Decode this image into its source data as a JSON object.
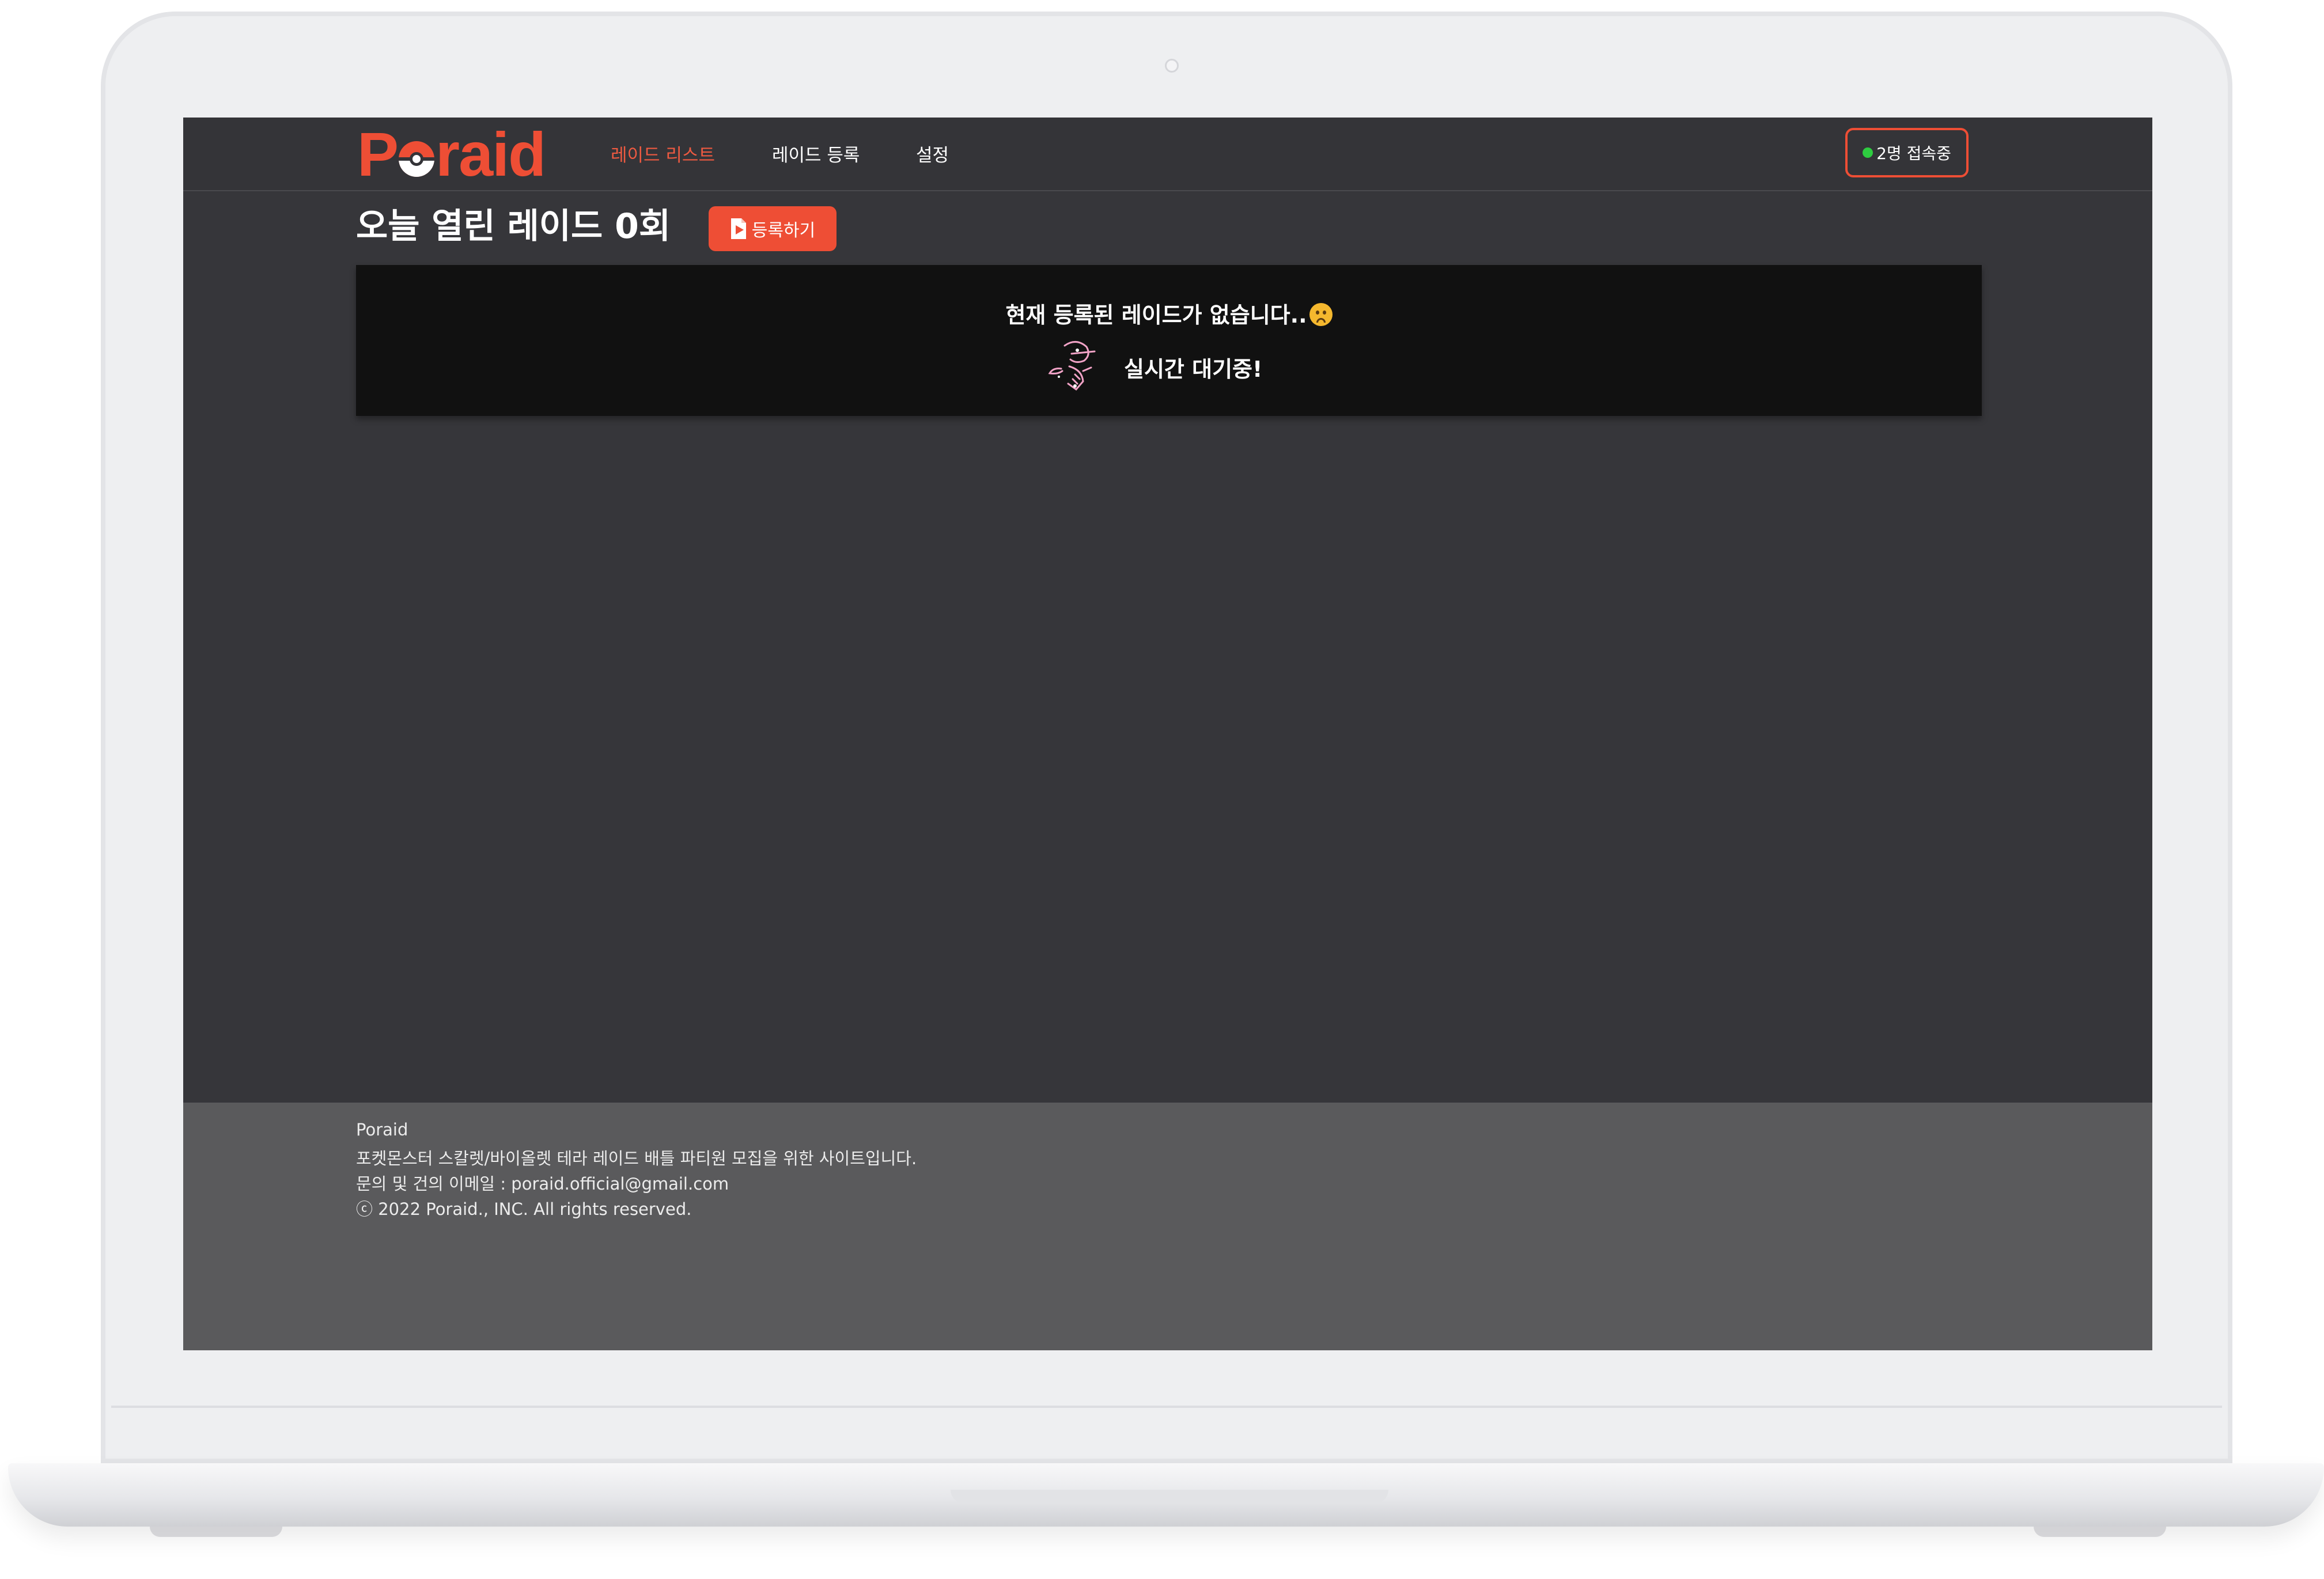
{
  "brand": {
    "logo_text_before": "P",
    "logo_text_after": "raid",
    "accent_color": "#ee4e35"
  },
  "nav": {
    "items": [
      {
        "label": "레이드 리스트",
        "active": true
      },
      {
        "label": "레이드 등록",
        "active": false
      },
      {
        "label": "설정",
        "active": false
      }
    ],
    "online_badge": "2명 접속중",
    "online_color": "#2ecc40"
  },
  "main": {
    "title": "오늘 열린 레이드 0회",
    "register_button": "등록하기",
    "register_icon": "document-arrow-icon",
    "empty_message": "현재 등록된 레이드가 없습니다..",
    "empty_emoji": "sad-face-icon",
    "waiting_text": "실시간 대기중!",
    "waiting_icon": "pokemon-sketch-icon"
  },
  "footer": {
    "lines": [
      "Poraid",
      "포켓몬스터 스칼렛/바이올렛 테라 레이드 배틀 파티원 모집을 위한 사이트입니다.",
      "문의 및 건의 이메일 : poraid.official@gmail.com",
      "ⓒ 2022 Poraid., INC. All rights reserved."
    ]
  }
}
